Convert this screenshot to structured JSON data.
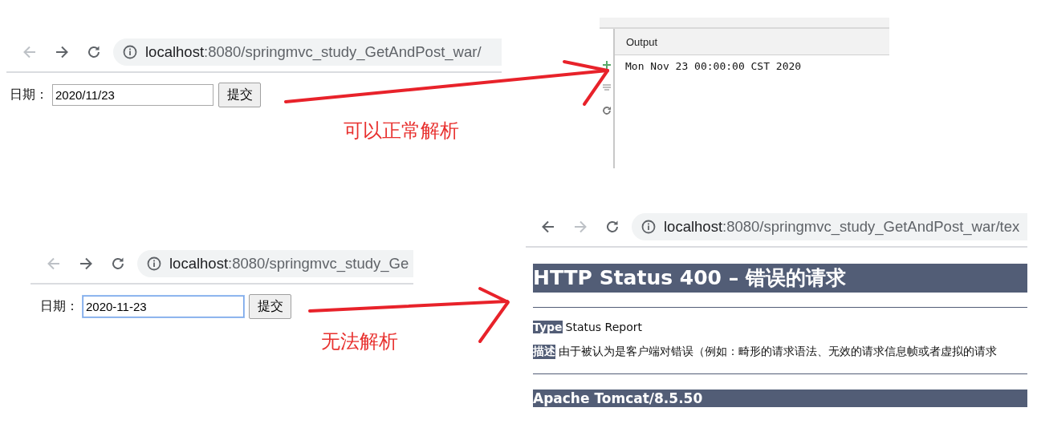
{
  "success_example": {
    "browser": {
      "back_disabled": true,
      "forward_disabled": false,
      "url_host": "localhost",
      "url_path": ":8080/springmvc_study_GetAndPost_war/"
    },
    "form": {
      "label": "日期：",
      "value": "2020/11/23",
      "button": "提交",
      "focused": false
    }
  },
  "output_panel": {
    "header": "Output",
    "lines": [
      "Mon Nov 23 00:00:00 CST 2020"
    ]
  },
  "success_note": "可以正常解析",
  "failure_example": {
    "browser": {
      "back_disabled": true,
      "forward_disabled": false,
      "url_host": "localhost",
      "url_path": ":8080/springmvc_study_Ge"
    },
    "form": {
      "label": "日期：",
      "value": "2020-11-23",
      "button": "提交",
      "focused": true
    }
  },
  "failure_note": "无法解析",
  "error_browser": {
    "browser": {
      "back_disabled": false,
      "forward_disabled": true,
      "url_host": "localhost",
      "url_path": ":8080/springmvc_study_GetAndPost_war/tex"
    },
    "page": {
      "title": "HTTP Status 400 – 错误的请求",
      "fields": [
        {
          "label": "Type",
          "value": "Status Report"
        },
        {
          "label": "描述",
          "value": "由于被认为是客户端对错误（例如：畸形的请求语法、无效的请求信息帧或者虚拟的请求"
        }
      ],
      "footer": "Apache Tomcat/8.5.50"
    }
  }
}
